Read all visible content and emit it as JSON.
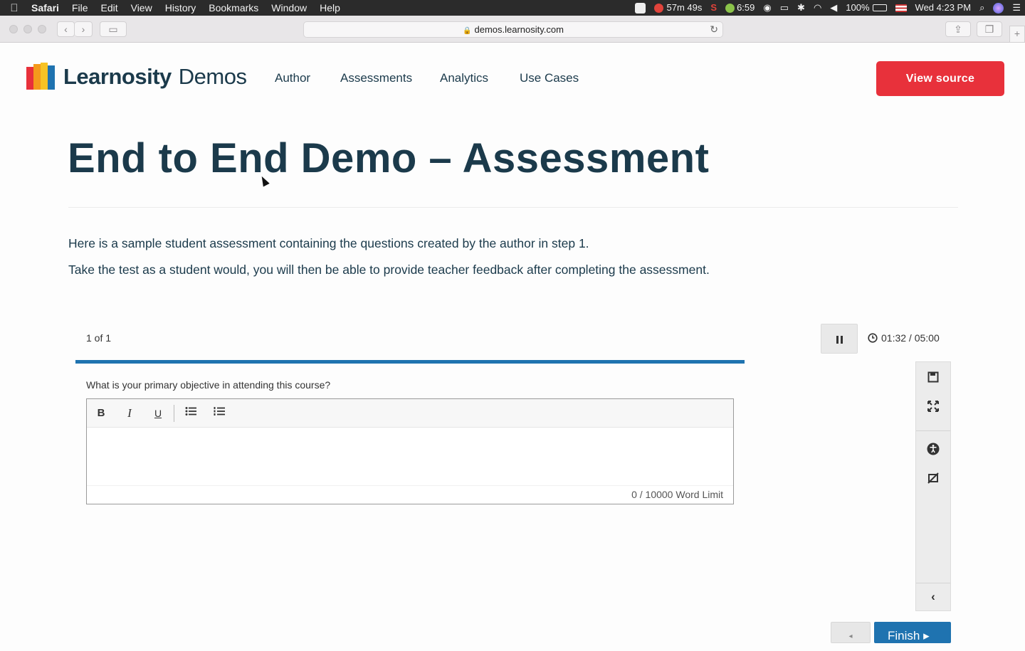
{
  "menubar": {
    "app_name": "Safari",
    "menus": [
      "File",
      "Edit",
      "View",
      "History",
      "Bookmarks",
      "Window",
      "Help"
    ],
    "status": {
      "timer_a": "57m 49s",
      "timer_b": "6:59",
      "battery": "100%",
      "datetime": "Wed 4:23 PM"
    }
  },
  "browser": {
    "url": "demos.learnosity.com"
  },
  "site": {
    "logo_word1": "Learnosity",
    "logo_word2": "Demos",
    "nav": [
      "Author",
      "Assessments",
      "Analytics",
      "Use Cases"
    ],
    "view_source_label": "View source",
    "brand_red": "#e8313b",
    "accent_blue": "#1f73b0"
  },
  "content": {
    "title": "End to End Demo – Assessment",
    "intro_1": "Here is a sample student assessment containing the questions created by the author in step 1.",
    "intro_2": "Take the test as a student would, you will then be able to provide teacher feedback after completing the assessment."
  },
  "assessment": {
    "counter": "1 of 1",
    "progress": 1.0,
    "timer": "01:32 / 05:00",
    "question": "What is your primary objective in attending this course?",
    "editor_tools": [
      "bold-icon",
      "italic-icon",
      "underline-icon",
      "bullet-list-icon",
      "numbered-list-icon"
    ],
    "word_count": "0 / 10000 Word Limit",
    "side_tools": [
      "save-icon",
      "fullscreen-icon",
      "accessibility-icon",
      "masking-icon",
      "collapse-icon"
    ],
    "finish_label": "Finish ▸",
    "prev_label": "◂"
  }
}
